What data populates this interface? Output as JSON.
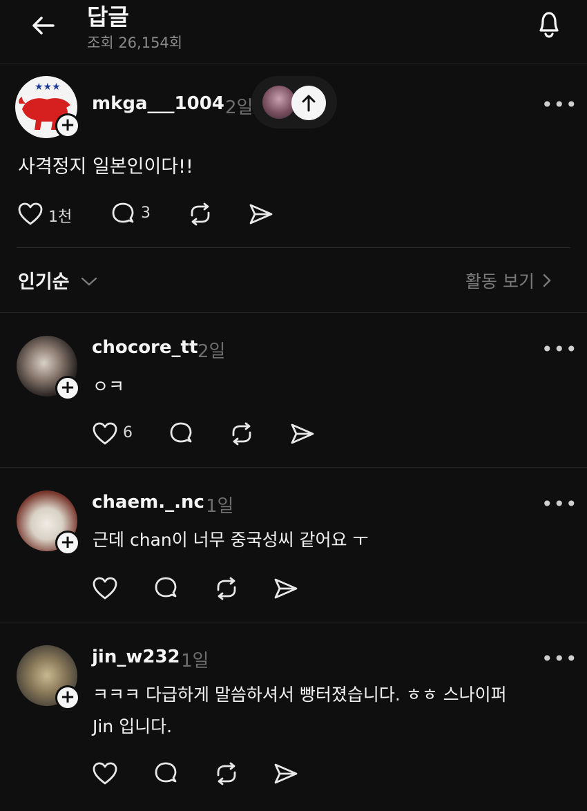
{
  "header": {
    "title": "답글",
    "views": "조회 26,154회"
  },
  "main_post": {
    "username": "mkga___1004",
    "time": "2일",
    "text": "사격정지 일본인이다!!",
    "likes": "1천",
    "comments": "3"
  },
  "sort": {
    "label": "인기순",
    "activity_label": "활동 보기"
  },
  "replies": [
    {
      "username": "chocore_tt",
      "time": "2일",
      "text": "ㅇㅋ",
      "likes": "6"
    },
    {
      "username": "chaem._.nc",
      "time": "1일",
      "text": "근데 chan이 너무 중국성씨 같어요 ㅜ",
      "likes": ""
    },
    {
      "username": "jin_w232",
      "time": "1일",
      "text_line1": "ㅋㅋㅋ 다급하게 말씀하셔서 빵터졌습니다. ㅎㅎ 스나이퍼",
      "text_line2": "Jin 입니다.",
      "likes": ""
    }
  ],
  "colors": {
    "background": "#0f0f0f",
    "text": "#f2f2f2",
    "muted": "#6e6e6e"
  }
}
